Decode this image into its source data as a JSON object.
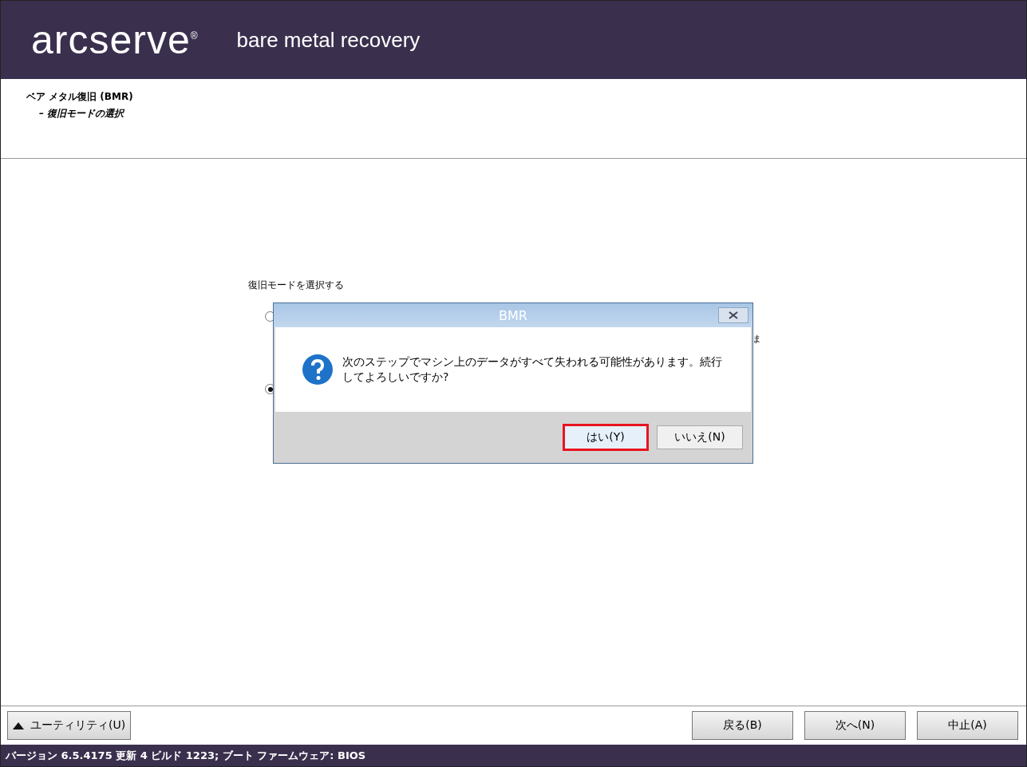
{
  "header": {
    "logo": "arcserve",
    "logo_mark": "®",
    "product": "bare metal recovery"
  },
  "page_title": {
    "title": "ベア メタル復旧 (BMR)",
    "subtitle": "– 復旧モードの選択"
  },
  "mode_group": {
    "label": "復旧モードを選択する",
    "options": [
      {
        "selected": false
      },
      {
        "selected": true
      }
    ],
    "fragment": "ま"
  },
  "dialog": {
    "title": "BMR",
    "message": "次のステップでマシン上のデータがすべて失われる可能性があります。続行してよろしいですか?",
    "buttons": [
      {
        "label": "はい(Y)",
        "focused": true
      },
      {
        "label": "いいえ(N)",
        "focused": false
      }
    ]
  },
  "utility_button": {
    "label": "ユーティリティ(U)"
  },
  "nav_buttons": [
    {
      "label": "戻る(B)"
    },
    {
      "label": "次へ(N)"
    },
    {
      "label": "中止(A)"
    }
  ],
  "status_bar": {
    "text": "バージョン 6.5.4175 更新 4 ビルド 1223; ブート ファームウェア: BIOS"
  }
}
